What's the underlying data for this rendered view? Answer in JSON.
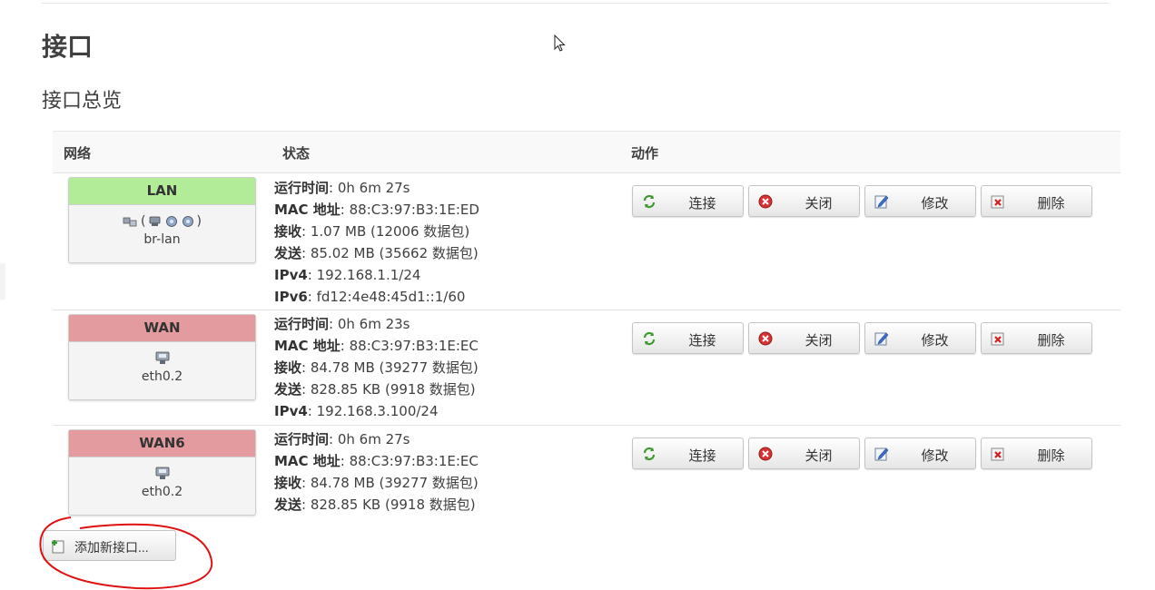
{
  "page": {
    "title": "接口",
    "section_title": "接口总览"
  },
  "table": {
    "headers": {
      "network": "网络",
      "status": "状态",
      "actions": "动作"
    },
    "status_labels": {
      "uptime": "运行时间",
      "mac": "MAC 地址",
      "rx": "接收",
      "tx": "发送",
      "ipv4": "IPv4",
      "ipv6": "IPv6"
    },
    "action_labels": {
      "connect": "连接",
      "stop": "关闭",
      "edit": "修改",
      "delete": "删除"
    },
    "rows": [
      {
        "name": "LAN",
        "color": "#b3ec99",
        "icons": "bridge-icon",
        "device": "br-lan",
        "bridge_open": "(",
        "bridge_close": ")",
        "uptime": "0h 6m 27s",
        "mac": "88:C3:97:B3:1E:ED",
        "rx": "1.07 MB (12006 数据包)",
        "tx": "85.02 MB (35662 数据包)",
        "ipv4": "192.168.1.1/24",
        "ipv6": "fd12:4e48:45d1::1/60"
      },
      {
        "name": "WAN",
        "color": "#e39b9f",
        "icons": "ethernet-port-icon",
        "device": "eth0.2",
        "uptime": "0h 6m 23s",
        "mac": "88:C3:97:B3:1E:EC",
        "rx": "84.78 MB (39277 数据包)",
        "tx": "828.85 KB (9918 数据包)",
        "ipv4": "192.168.3.100/24"
      },
      {
        "name": "WAN6",
        "color": "#e39b9f",
        "icons": "ethernet-port-icon",
        "device": "eth0.2",
        "uptime": "0h 6m 27s",
        "mac": "88:C3:97:B3:1E:EC",
        "rx": "84.78 MB (39277 数据包)",
        "tx": "828.85 KB (9918 数据包)"
      }
    ]
  },
  "add_button": {
    "label": "添加新接口..."
  }
}
